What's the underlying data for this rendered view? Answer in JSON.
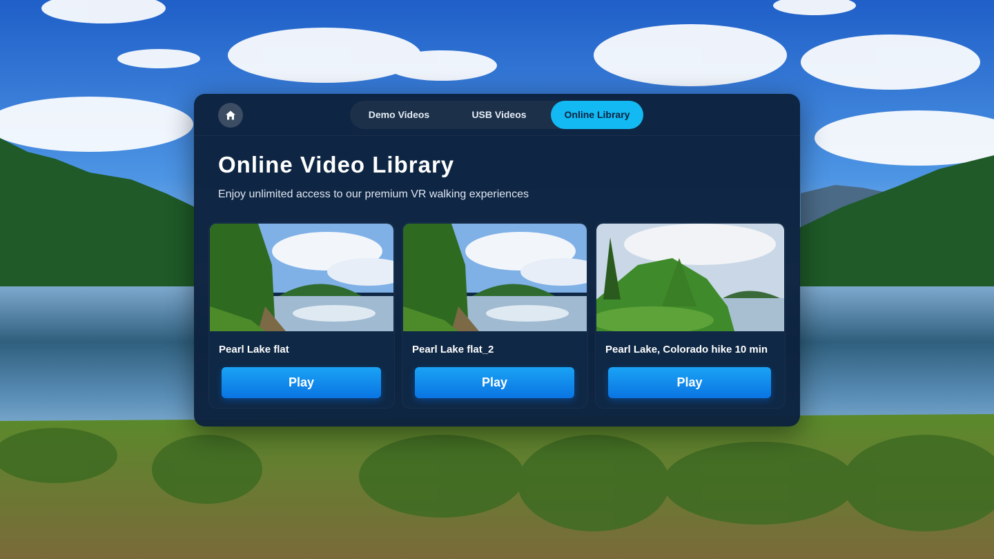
{
  "colors": {
    "panel": "#0c223e",
    "accent": "#12b9f2",
    "play_button": "#0a84ea",
    "tab_bar": "#1d3049"
  },
  "nav": {
    "home_icon": "home-icon",
    "tabs": [
      {
        "label": "Demo Videos",
        "active": false
      },
      {
        "label": "USB Videos",
        "active": false
      },
      {
        "label": "Online Library",
        "active": true
      }
    ]
  },
  "main": {
    "title": "Online Video Library",
    "subtitle": "Enjoy unlimited access to our premium VR walking experiences",
    "videos": [
      {
        "title": "Pearl Lake flat",
        "button": "Play"
      },
      {
        "title": "Pearl Lake flat_2",
        "button": "Play"
      },
      {
        "title": "Pearl Lake, Colorado hike 10 min",
        "button": "Play"
      }
    ]
  }
}
